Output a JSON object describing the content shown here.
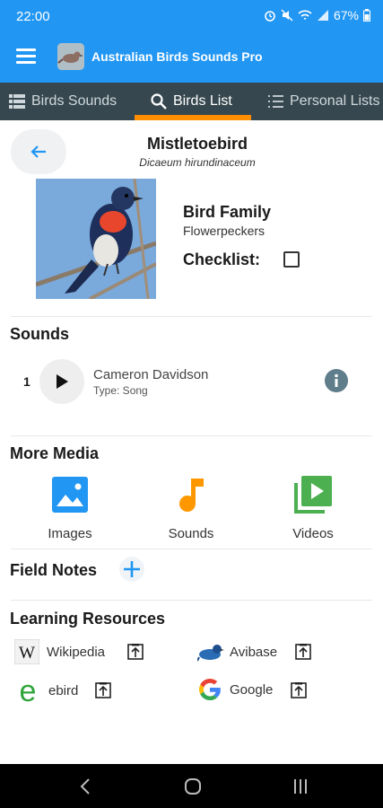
{
  "status_bar": {
    "time": "22:00",
    "battery": "67%"
  },
  "app_bar": {
    "title": "Australian Birds Sounds Pro"
  },
  "tabs": [
    {
      "label": "Birds Sounds",
      "icon": "list-grid-icon"
    },
    {
      "label": "Birds List",
      "icon": "search-icon",
      "active": true
    },
    {
      "label": "Personal Lists",
      "icon": "checklist-icon"
    }
  ],
  "bird": {
    "name": "Mistletoebird",
    "scientific_name": "Dicaeum hirundinaceum",
    "family_heading": "Bird Family",
    "family": "Flowerpeckers",
    "checklist_label": "Checklist:"
  },
  "sounds": {
    "title": "Sounds",
    "items": [
      {
        "index": "1",
        "author": "Cameron Davidson",
        "type": "Type: Song"
      }
    ]
  },
  "more_media": {
    "title": "More Media",
    "items": [
      {
        "label": "Images",
        "icon": "image-icon",
        "color": "#2196f3"
      },
      {
        "label": "Sounds",
        "icon": "music-note-icon",
        "color": "#ff9800"
      },
      {
        "label": "Videos",
        "icon": "video-library-icon",
        "color": "#4caf50"
      }
    ]
  },
  "field_notes": {
    "title": "Field Notes"
  },
  "learning_resources": {
    "title": "Learning Resources",
    "items": [
      {
        "label": "Wikipedia",
        "icon": "wikipedia-icon"
      },
      {
        "label": "Avibase",
        "icon": "avibase-icon"
      },
      {
        "label": "ebird",
        "icon": "ebird-icon"
      },
      {
        "label": "Google",
        "icon": "google-icon"
      }
    ]
  },
  "colors": {
    "primary": "#2196f3",
    "tab_bar": "#37474f",
    "accent": "#ff8f00"
  }
}
